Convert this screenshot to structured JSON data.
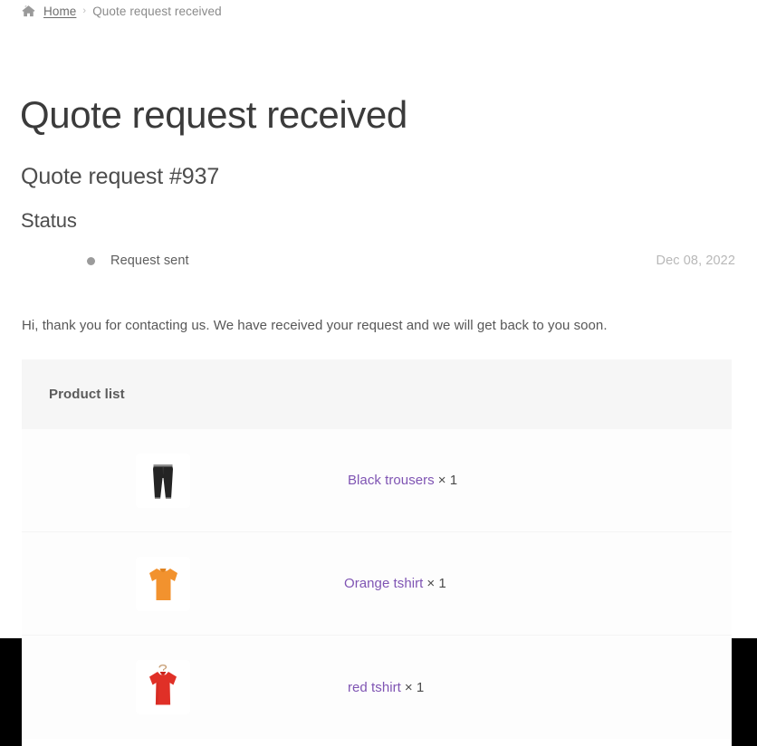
{
  "breadcrumb": {
    "home_icon": "home-icon",
    "home_label": "Home",
    "separator": "›",
    "current": "Quote request received"
  },
  "page": {
    "title": "Quote request received",
    "order_number": "Quote request #937",
    "status_heading": "Status",
    "message": "Hi, thank you for contacting us. We have received your request and we will get back to you soon."
  },
  "status": {
    "dot_icon": "status-dot-icon",
    "label": "Request sent",
    "date": "Dec 08, 2022",
    "dot_color": "#9b9b9b"
  },
  "product_list": {
    "header_label": "Product list",
    "link_color": "#7f54b3",
    "rows": [
      {
        "image": "black-trousers-thumbnail",
        "name": "Black trousers",
        "quantity": "× 1"
      },
      {
        "image": "orange-tshirt-thumbnail",
        "name": "Orange tshirt",
        "quantity": "× 1"
      },
      {
        "image": "red-tshirt-thumbnail",
        "name": "red tshirt",
        "quantity": "× 1"
      }
    ]
  }
}
